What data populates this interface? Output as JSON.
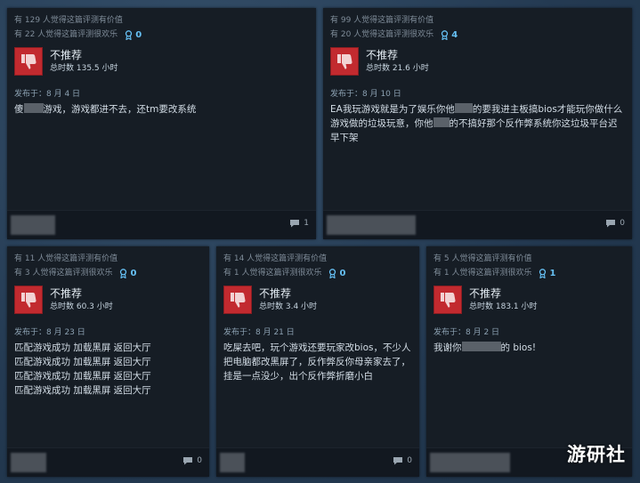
{
  "reviews": [
    {
      "helpful": "有 129 人觉得这篇评测有价值",
      "funny": "有 22 人觉得这篇评测很欢乐",
      "awards": "0",
      "recommendation": "不推荐",
      "hours": "总时数 135.5 小时",
      "posted": "发布于：8 月 4 日",
      "content": [
        "傻",
        "游戏，游戏都进不去，还tm要改系统"
      ],
      "comments": "1"
    },
    {
      "helpful": "有 99 人觉得这篇评测有价值",
      "funny": "有 20 人觉得这篇评测很欢乐",
      "awards": "4",
      "recommendation": "不推荐",
      "hours": "总时数 21.6 小时",
      "posted": "发布于：8 月 10 日",
      "content": [
        "EA我玩游戏就是为了娱乐你他",
        "的要我进主板搞bios才能玩你做什么游戏做的垃圾玩意，你他",
        "的不搞好那个反作弊系统你这垃圾平台迟早下架"
      ],
      "comments": "0"
    },
    {
      "helpful": "有 11 人觉得这篇评测有价值",
      "funny": "有 3 人觉得这篇评测很欢乐",
      "awards": "0",
      "recommendation": "不推荐",
      "hours": "总时数 60.3 小时",
      "posted": "发布于：8 月 23 日",
      "content": [
        "匹配游戏成功 加载黑屏 返回大厅",
        "匹配游戏成功 加载黑屏 返回大厅",
        "匹配游戏成功 加载黑屏 返回大厅",
        "匹配游戏成功 加载黑屏 返回大厅"
      ],
      "comments": "0"
    },
    {
      "helpful": "有 14 人觉得这篇评测有价值",
      "funny": "有 1 人觉得这篇评测很欢乐",
      "awards": "0",
      "recommendation": "不推荐",
      "hours": "总时数 3.4 小时",
      "posted": "发布于：8 月 21 日",
      "content": [
        "吃屎去吧，玩个游戏还要玩家改bios，不少人把电脑都改黑屏了，反作弊反你母亲家去了，挂是一点没少，出个反作弊折磨小白"
      ],
      "comments": "0"
    },
    {
      "helpful": "有 5 人觉得这篇评测有价值",
      "funny": "有 1 人觉得这篇评测很欢乐",
      "awards": "1",
      "recommendation": "不推荐",
      "hours": "总时数 183.1 小时",
      "posted": "发布于：8 月 2 日",
      "content": [
        "我谢你",
        "的 bios!"
      ],
      "comments": "0"
    }
  ],
  "watermark": "游研社",
  "colors": {
    "thumb_red": "#c22a2f",
    "award_blue": "#66c0f4",
    "card_bg": "#161d25"
  }
}
